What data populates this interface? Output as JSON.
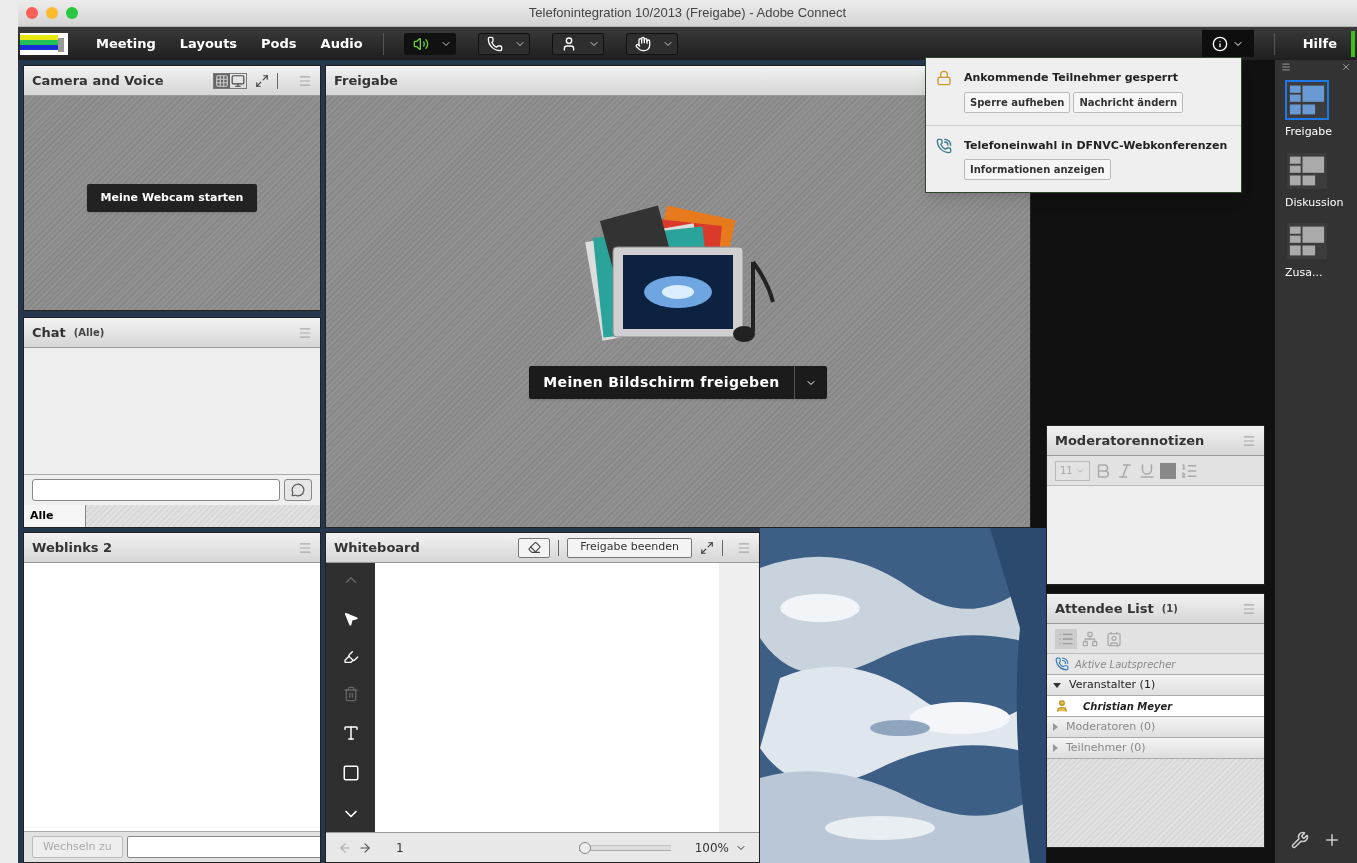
{
  "window": {
    "title": "Telefonintegration 10/2013 (Freigabe) - Adobe Connect"
  },
  "menu": [
    "Meeting",
    "Layouts",
    "Pods",
    "Audio"
  ],
  "toolbar": [
    {
      "kind": "speaker",
      "active": true
    },
    {
      "kind": "phone",
      "active": false
    },
    {
      "kind": "webcam",
      "active": false
    },
    {
      "kind": "hand",
      "active": false
    }
  ],
  "help": "Hilfe",
  "notifications": [
    {
      "kind": "lock",
      "title": "Ankommende Teilnehmer gesperrt",
      "buttons": [
        "Sperre aufheben",
        "Nachricht ändern"
      ]
    },
    {
      "kind": "phone",
      "title": "Telefoneinwahl in DFNVC-Webkonferenzen",
      "buttons": [
        "Informationen anzeigen"
      ]
    }
  ],
  "camera": {
    "title": "Camera and Voice",
    "button": "Meine Webcam starten"
  },
  "share": {
    "title": "Freigabe",
    "button": "Meinen Bildschirm freigeben"
  },
  "chat": {
    "title": "Chat",
    "scope": "(Alle)",
    "tab": "Alle"
  },
  "weblinks": {
    "title": "Weblinks 2",
    "button": "Wechseln zu"
  },
  "whiteboard": {
    "title": "Whiteboard",
    "button": "Freigabe beenden",
    "page": "1",
    "zoom": "100%",
    "level": 0
  },
  "notes": {
    "title": "Moderatorennotizen",
    "font_size": "11"
  },
  "attendees": {
    "title": "Attendee List",
    "count": "(1)",
    "speakers": "Aktive Lautsprecher",
    "groups": [
      {
        "label": "Veranstalter (1)",
        "expanded": true,
        "members": [
          "Christian Meyer"
        ]
      },
      {
        "label": "Moderatoren (0)",
        "expanded": false
      },
      {
        "label": "Teilnehmer (0)",
        "expanded": false
      }
    ]
  },
  "layouts": [
    {
      "label": "Freigabe",
      "selected": true
    },
    {
      "label": "Diskussion",
      "selected": false
    },
    {
      "label": "Zusa...",
      "selected": false
    }
  ]
}
